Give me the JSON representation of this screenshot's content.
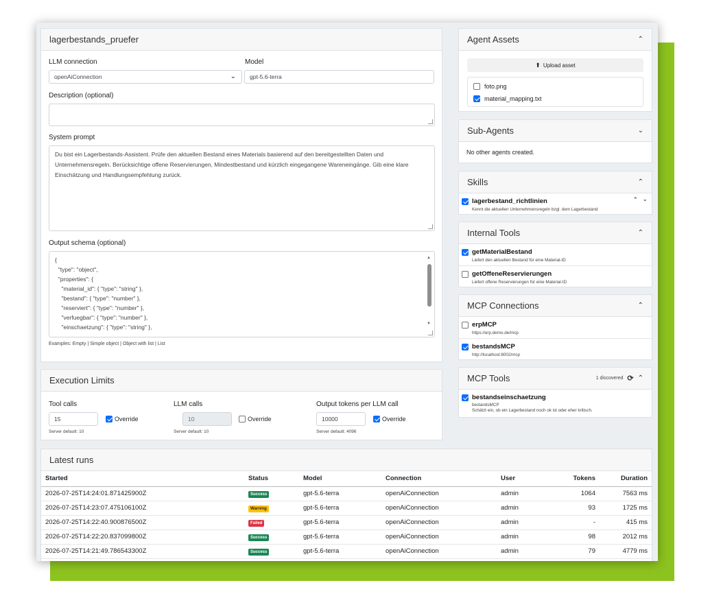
{
  "agent": {
    "name": "lagerbestands_pruefer",
    "llm_connection_label": "LLM connection",
    "llm_connection_value": "openAiConnection",
    "model_label": "Model",
    "model_value": "gpt-5.6-terra",
    "description_label": "Description (optional)",
    "description_value": "",
    "system_prompt_label": "System prompt",
    "system_prompt_value": "Du bist ein Lagerbestands-Assistent. Prüfe den aktuellen Bestand eines Materials basierend auf den bereitgestellten Daten und Unternehmensregeln. Berücksichtige offene Reservierungen, Mindestbestand und kürzlich eingegangene Wareneingänge. Gib eine klare Einschätzung und Handlungsempfehlung zurück.",
    "output_schema_label": "Output schema (optional)",
    "output_schema_lines": [
      "{",
      "  \"type\": \"object\",",
      "  \"properties\": {",
      "    \"material_id\": { \"type\": \"string\" },",
      "    \"bestand\": { \"type\": \"number\" },",
      "    \"reserviert\": { \"type\": \"number\" },",
      "    \"verfuegbar\": { \"type\": \"number\" },",
      "    \"einschaetzung\": { \"type\": \"string\" },"
    ],
    "examples_prefix": "Examples:",
    "examples": [
      "Empty",
      "Simple object",
      "Object with list",
      "List"
    ]
  },
  "limits": {
    "title": "Execution Limits",
    "tool_calls": {
      "label": "Tool calls",
      "value": "15",
      "override_label": "Override",
      "override": true,
      "server_default": "Server default: 10"
    },
    "llm_calls": {
      "label": "LLM calls",
      "value": "10",
      "override_label": "Override",
      "override": false,
      "server_default": "Server default: 10"
    },
    "output_tokens": {
      "label": "Output tokens per LLM call",
      "value": "10000",
      "override_label": "Override",
      "override": true,
      "server_default": "Server default: 4096"
    }
  },
  "assets": {
    "title": "Agent Assets",
    "upload_label": "Upload asset",
    "files": [
      {
        "name": "foto.png",
        "checked": false
      },
      {
        "name": "material_mapping.txt",
        "checked": true
      }
    ]
  },
  "sub_agents": {
    "title": "Sub-Agents",
    "empty_text": "No other agents created."
  },
  "skills": {
    "title": "Skills",
    "items": [
      {
        "name": "lagerbestand_richtlinien",
        "desc": "Kennt die aktuellen Unternehmensregeln bzgl. dem Lagerbestand",
        "checked": true
      }
    ]
  },
  "internal_tools": {
    "title": "Internal Tools",
    "items": [
      {
        "name": "getMaterialBestand",
        "desc": "Liefert den aktuellen Bestand für eine Material-ID",
        "checked": true
      },
      {
        "name": "getOffeneReservierungen",
        "desc": "Liefert offene Reservierungen für eine Material-ID",
        "checked": false
      }
    ]
  },
  "mcp_connections": {
    "title": "MCP Connections",
    "items": [
      {
        "name": "erpMCP",
        "url": "https://erp.demo.de/mcp",
        "checked": false
      },
      {
        "name": "bestandsMCP",
        "url": "http://localhost:8002/mcp",
        "checked": true
      }
    ]
  },
  "mcp_tools": {
    "title": "MCP Tools",
    "discovered": "1 discovered",
    "items": [
      {
        "name": "bestandseinschaetzung",
        "source": "bestandsMCP",
        "desc": "Schätzt ein, ob ein Lagerbestand noch ok ist oder eher kritisch.",
        "checked": true
      }
    ]
  },
  "runs": {
    "title": "Latest runs",
    "columns": [
      "Started",
      "Status",
      "Model",
      "Connection",
      "User",
      "Tokens",
      "Duration"
    ],
    "rows": [
      {
        "started": "2026-07-25T14:24:01.871425900Z",
        "status": "Success",
        "model": "gpt-5.6-terra",
        "connection": "openAiConnection",
        "user": "admin",
        "tokens": "1064",
        "duration": "7563 ms"
      },
      {
        "started": "2026-07-25T14:23:07.475106100Z",
        "status": "Warning",
        "model": "gpt-5.6-terra",
        "connection": "openAiConnection",
        "user": "admin",
        "tokens": "93",
        "duration": "1725 ms"
      },
      {
        "started": "2026-07-25T14:22:40.900876500Z",
        "status": "Failed",
        "model": "gpt-5.6-terra",
        "connection": "openAiConnection",
        "user": "admin",
        "tokens": "-",
        "duration": "415 ms"
      },
      {
        "started": "2026-07-25T14:22:20.837099800Z",
        "status": "Success",
        "model": "gpt-5.6-terra",
        "connection": "openAiConnection",
        "user": "admin",
        "tokens": "98",
        "duration": "2012 ms"
      },
      {
        "started": "2026-07-25T14:21:49.786543300Z",
        "status": "Success",
        "model": "gpt-5.6-terra",
        "connection": "openAiConnection",
        "user": "admin",
        "tokens": "79",
        "duration": "4779 ms"
      }
    ]
  },
  "colors": {
    "accent": "#8dc31f",
    "checkbox": "#0d6efd",
    "success": "#198754",
    "warning": "#ffc107",
    "failed": "#dc3545"
  }
}
